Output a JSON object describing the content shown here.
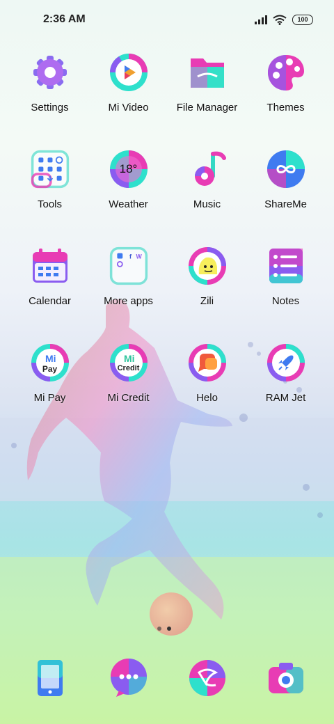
{
  "status_bar": {
    "time": "2:36 AM",
    "battery": "100"
  },
  "apps": [
    {
      "label": "Settings",
      "icon": "settings-icon"
    },
    {
      "label": "Mi Video",
      "icon": "mi-video-icon"
    },
    {
      "label": "File Manager",
      "icon": "file-manager-icon"
    },
    {
      "label": "Themes",
      "icon": "themes-icon"
    },
    {
      "label": "Tools",
      "icon": "tools-icon"
    },
    {
      "label": "Weather",
      "icon": "weather-icon",
      "badge": "18°"
    },
    {
      "label": "Music",
      "icon": "music-icon"
    },
    {
      "label": "ShareMe",
      "icon": "shareme-icon"
    },
    {
      "label": "Calendar",
      "icon": "calendar-icon"
    },
    {
      "label": "More apps",
      "icon": "more-apps-folder-icon"
    },
    {
      "label": "Zili",
      "icon": "zili-icon"
    },
    {
      "label": "Notes",
      "icon": "notes-icon"
    },
    {
      "label": "Mi Pay",
      "icon": "mi-pay-icon",
      "badge": "Pay"
    },
    {
      "label": "Mi Credit",
      "icon": "mi-credit-icon",
      "badge": "Credit"
    },
    {
      "label": "Helo",
      "icon": "helo-icon"
    },
    {
      "label": "RAM Jet",
      "icon": "ram-jet-icon"
    }
  ],
  "dock": [
    {
      "icon": "phone-icon"
    },
    {
      "icon": "messaging-icon"
    },
    {
      "icon": "browser-icon"
    },
    {
      "icon": "camera-icon"
    }
  ],
  "page_indicator": {
    "pages": 2,
    "active": 2
  },
  "colors": {
    "accent_pink": "#f03cb4",
    "accent_cyan": "#3ee0d0",
    "accent_purple": "#8a5cf0",
    "accent_blue": "#3f7bf0"
  }
}
